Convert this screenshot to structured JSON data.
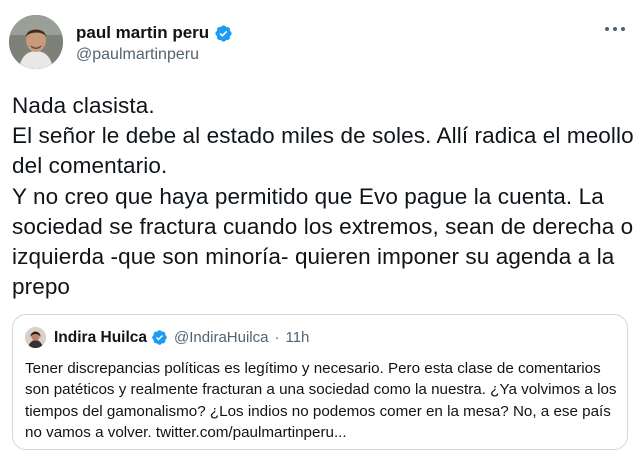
{
  "author": {
    "display_name": "paul martin peru",
    "handle": "@paulmartinperu"
  },
  "tweet_text": "Nada clasista.\nEl señor le debe al estado miles de soles. Allí radica el meollo del comentario.\nY no creo que haya permitido que Evo pague la cuenta. La sociedad se fractura cuando los extremos, sean de derecha o izquierda -que son minoría- quieren imponer su agenda a la prepo",
  "quoted": {
    "display_name": "Indira Huilca",
    "handle": "@IndiraHuilca",
    "separator": "·",
    "time": "11h",
    "text": "Tener discrepancias políticas es legítimo y necesario. Pero esta clase de comentarios son patéticos y realmente fracturan a una sociedad como la nuestra. ¿Ya volvimos a los tiempos del gamonalismo? ¿Los indios no podemos comer en la mesa? No, a ese país no vamos a volver. twitter.com/paulmartinperu..."
  },
  "colors": {
    "verified": "#1d9bf0",
    "text": "#0f1419",
    "secondary": "#536471",
    "border": "#cfd9de"
  },
  "icons": [
    "verified-badge-icon",
    "more-options-icon"
  ]
}
